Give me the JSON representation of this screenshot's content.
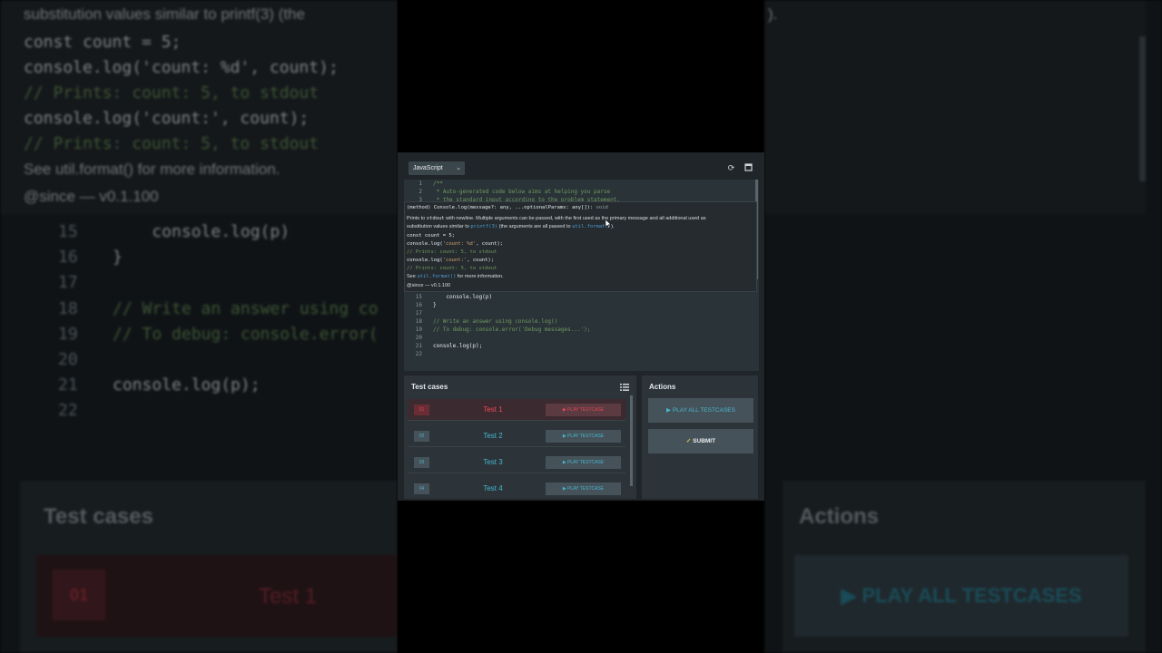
{
  "editor": {
    "language": "JavaScript",
    "lines": [
      {
        "n": "1",
        "code": "/**",
        "kind": "comment"
      },
      {
        "n": "2",
        "code": " * Auto-generated code below aims at helping you parse",
        "kind": "comment"
      },
      {
        "n": "3",
        "code": " * the standard input according to the problem statement.",
        "kind": "comment"
      },
      {
        "n": "15",
        "code": "    console.log(p)",
        "kind": "code"
      },
      {
        "n": "16",
        "code": "}",
        "kind": "code"
      },
      {
        "n": "17",
        "code": "",
        "kind": "code"
      },
      {
        "n": "18",
        "code": "// Write an answer using console.log()",
        "kind": "comment"
      },
      {
        "n": "19",
        "code": "// To debug: console.error('Debug messages...');",
        "kind": "comment"
      },
      {
        "n": "20",
        "code": "",
        "kind": "code"
      },
      {
        "n": "21",
        "code": "console.log(p);",
        "kind": "code"
      },
      {
        "n": "22",
        "code": "",
        "kind": "code"
      }
    ]
  },
  "tooltip": {
    "signature": "(method) Console.log(message?: any, ...optionalParams: any[]): ",
    "signature_type": "void",
    "desc_1a": "Prints to ",
    "desc_1b": "stdout",
    "desc_1c": " with newline. Multiple arguments can be passed, with the first used as the primary message and all additional used as",
    "desc_2a": "substitution values similar to ",
    "desc_2b": "printf(3)",
    "desc_2c": " (the arguments are all passed to ",
    "desc_2d": "util.format()",
    "desc_2e": ").",
    "ex_1": "const count = 5;",
    "ex_2a": "console.log(",
    "ex_2b": "'count: %d'",
    "ex_2c": ", count);",
    "ex_3": "// Prints: count: 5, to stdout",
    "ex_4a": "console.log(",
    "ex_4b": "'count:'",
    "ex_4c": ", count);",
    "ex_5": "// Prints: count: 5, to stdout",
    "see_a": "See ",
    "see_b": "util.format()",
    "see_c": " for more information.",
    "since": "@since — v0.1.100"
  },
  "test_cases": {
    "title": "Test cases",
    "rows": [
      {
        "num": "01",
        "name": "Test 1",
        "button": "▶ PLAY TESTCASE",
        "active": true
      },
      {
        "num": "02",
        "name": "Test 2",
        "button": "▶ PLAY TESTCASE",
        "active": false
      },
      {
        "num": "03",
        "name": "Test 3",
        "button": "▶ PLAY TESTCASE",
        "active": false
      },
      {
        "num": "04",
        "name": "Test 4",
        "button": "▶ PLAY TESTCASE",
        "active": false
      }
    ]
  },
  "actions": {
    "title": "Actions",
    "play_all": "▶ PLAY ALL TESTCASES",
    "submit": "SUBMIT"
  },
  "background": {
    "tooltip_lines": [
      "substitution values similar to  printf(3)  (the",
      "const count = 5;",
      "console.log('count: %d', count);",
      "// Prints: count: 5, to stdout",
      "console.log('count:', count);",
      "// Prints: count: 5, to stdout",
      "See  util.format()  for more information.",
      "@since — v0.1.100"
    ],
    "code_lines": [
      {
        "n": "15",
        "code": "    console.log(p)"
      },
      {
        "n": "16",
        "code": "}"
      },
      {
        "n": "17",
        "code": ""
      },
      {
        "n": "18",
        "code": "// Write an answer using co"
      },
      {
        "n": "19",
        "code": "// To debug: console.error("
      },
      {
        "n": "20",
        "code": ""
      },
      {
        "n": "21",
        "code": "console.log(p);"
      },
      {
        "n": "22",
        "code": ""
      }
    ],
    "right_fragment": ").",
    "tc_title": "Test cases",
    "tc_num": "01",
    "tc_name": "Test 1",
    "ac_title": "Actions",
    "ac_play": "▶ PLAY ALL TESTCASES"
  },
  "colors": {
    "accent": "#46b6cf",
    "error": "#ee4b5a",
    "panel": "#2c3439",
    "editor": "#2a3338"
  }
}
